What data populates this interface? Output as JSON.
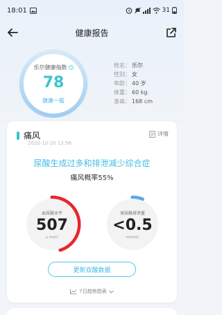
{
  "status_bar": {
    "time": "18:01",
    "battery": "31"
  },
  "nav": {
    "title": "健康报告"
  },
  "score": {
    "label": "乐尔健康指数",
    "value": "78",
    "status": "健康一般"
  },
  "profile": {
    "rows": [
      {
        "key": "姓名：",
        "value": "乐尔"
      },
      {
        "key": "性别：",
        "value": "女"
      },
      {
        "key": "年龄：",
        "value": "40 岁"
      },
      {
        "key": "体重：",
        "value": "60 kg"
      },
      {
        "key": "身高：",
        "value": "168 cm"
      }
    ]
  },
  "card": {
    "title": "痛风",
    "date": "2020-10-20 13:56",
    "detail_label": "详情",
    "syndrome": "尿酸生成过多和排泄减少综合症",
    "probability": "痛风概率55%",
    "gauge_left": {
      "label": "血尿酸水平",
      "value": "507",
      "unit": "μ mol/L",
      "level": 0.45,
      "color": "#e8262d"
    },
    "gauge_right": {
      "label": "肾尿酸排泄量",
      "value": "<0.5",
      "unit": "mmol/L",
      "level": 0.06,
      "color": "#5aa8ea"
    },
    "update_button": "更新双酸数据",
    "trend_link": "7日趋势图表"
  },
  "colors": {
    "accent": "#36c3d0",
    "blue": "#45b9e9",
    "red": "#e8262d"
  }
}
